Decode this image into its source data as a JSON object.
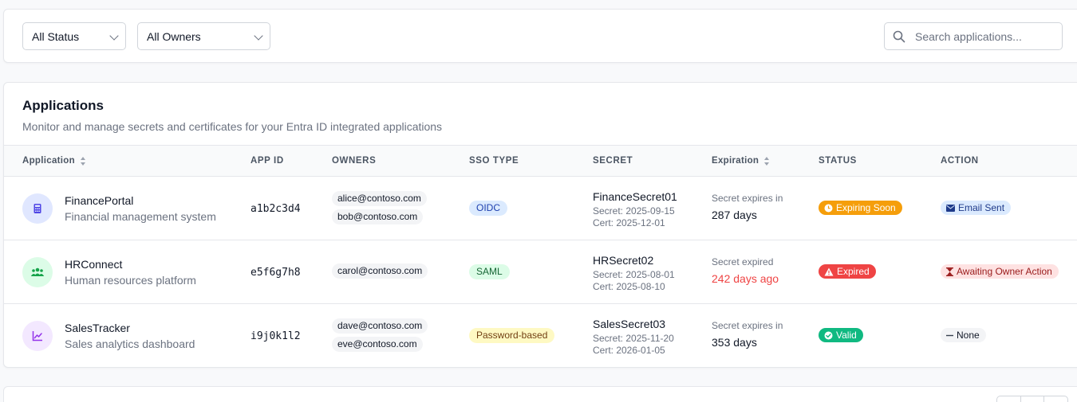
{
  "filters": {
    "status_value": "All Status",
    "owners_value": "All Owners",
    "search_placeholder": "Search applications..."
  },
  "card": {
    "title": "Applications",
    "subtitle": "Monitor and manage secrets and certificates for your Entra ID integrated applications"
  },
  "columns": {
    "application": "Application",
    "app_id": "APP ID",
    "owners": "OWNERS",
    "sso_type": "SSO TYPE",
    "secret": "SECRET",
    "expiration": "Expiration",
    "status": "STATUS",
    "action": "ACTION"
  },
  "rows": [
    {
      "name": "FinancePortal",
      "desc": "Financial management system",
      "icon": "calculator-icon",
      "app_id": "a1b2c3d4",
      "owners": [
        "alice@contoso.com",
        "bob@contoso.com"
      ],
      "sso": "OIDC",
      "secret_name": "FinanceSecret01",
      "secret_date": "Secret: 2025-09-15",
      "cert_date": "Cert: 2025-12-01",
      "exp_label": "Secret expires in",
      "exp_value": "287 days",
      "status": "Expiring Soon",
      "action": "Email Sent"
    },
    {
      "name": "HRConnect",
      "desc": "Human resources platform",
      "icon": "users-icon",
      "app_id": "e5f6g7h8",
      "owners": [
        "carol@contoso.com"
      ],
      "sso": "SAML",
      "secret_name": "HRSecret02",
      "secret_date": "Secret: 2025-08-01",
      "cert_date": "Cert: 2025-08-10",
      "exp_label": "Secret expired",
      "exp_value": "242 days ago",
      "status": "Expired",
      "action": "Awaiting Owner Action"
    },
    {
      "name": "SalesTracker",
      "desc": "Sales analytics dashboard",
      "icon": "chart-line-icon",
      "app_id": "i9j0k1l2",
      "owners": [
        "dave@contoso.com",
        "eve@contoso.com"
      ],
      "sso": "Password-based",
      "secret_name": "SalesSecret03",
      "secret_date": "Secret: 2025-11-20",
      "cert_date": "Cert: 2026-01-05",
      "exp_label": "Secret expires in",
      "exp_value": "353 days",
      "status": "Valid",
      "action": "None"
    }
  ],
  "colors": {
    "expiring": "#f59e0b",
    "expired": "#ef4444",
    "valid": "#10b981",
    "expired_text": "#ef4444"
  }
}
